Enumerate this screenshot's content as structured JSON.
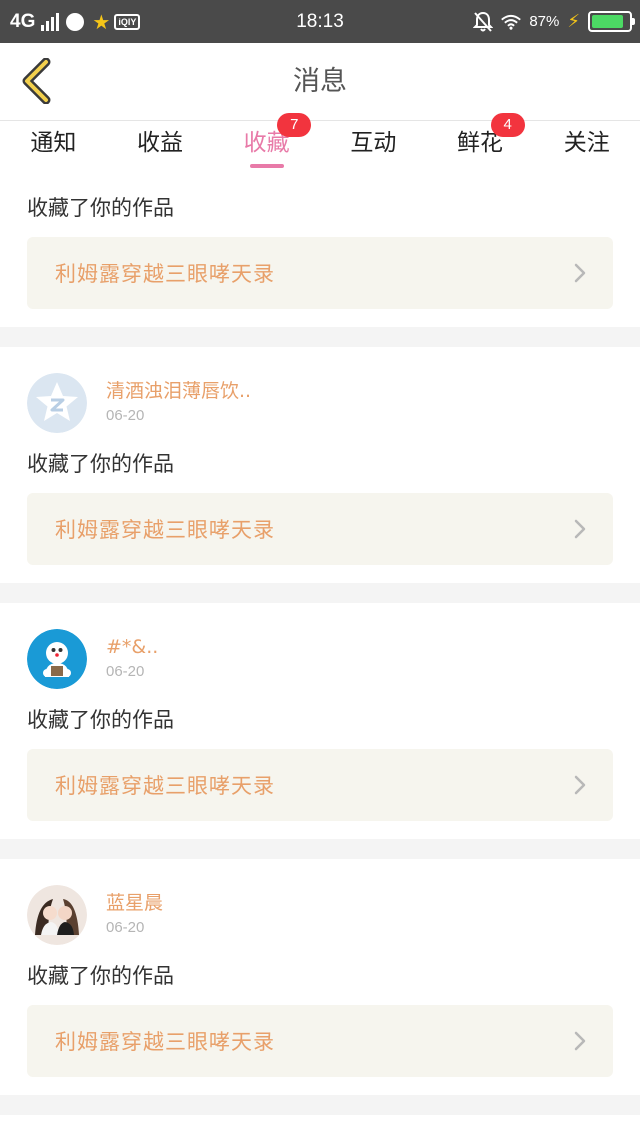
{
  "status_bar": {
    "network": "4G",
    "time": "18:13",
    "battery_percent": "87%",
    "battery_level": 0.87,
    "icons": [
      "signal-icon",
      "app-circle-icon",
      "star-icon",
      "qiyi-icon",
      "mute-bell-icon",
      "wifi-icon",
      "charging-icon",
      "battery-icon"
    ]
  },
  "header": {
    "title": "消息",
    "back_icon": "chevron-left-icon"
  },
  "tabs": [
    {
      "label": "通知",
      "badge": "",
      "active": false
    },
    {
      "label": "收益",
      "badge": "",
      "active": false
    },
    {
      "label": "收藏",
      "badge": "7",
      "active": true
    },
    {
      "label": "互动",
      "badge": "",
      "active": false
    },
    {
      "label": "鲜花",
      "badge": "4",
      "active": false
    },
    {
      "label": "关注",
      "badge": "",
      "active": false
    }
  ],
  "feed": [
    {
      "user": "",
      "date": "",
      "action": "收藏了你的作品",
      "work_title": "利姆露穿越三眼哮天录"
    },
    {
      "user": "清酒浊泪薄唇饮..",
      "date": "06-20",
      "action": "收藏了你的作品",
      "work_title": "利姆露穿越三眼哮天录"
    },
    {
      "user": "#*&..",
      "date": "06-20",
      "action": "收藏了你的作品",
      "work_title": "利姆露穿越三眼哮天录"
    },
    {
      "user": "蓝星晨",
      "date": "06-20",
      "action": "收藏了你的作品",
      "work_title": "利姆露穿越三眼哮天录"
    }
  ],
  "colors": {
    "accent_pink": "#e87aa8",
    "badge_red": "#f2343e",
    "username_orange": "#e8a06a",
    "work_box_bg": "#f6f5ee"
  }
}
